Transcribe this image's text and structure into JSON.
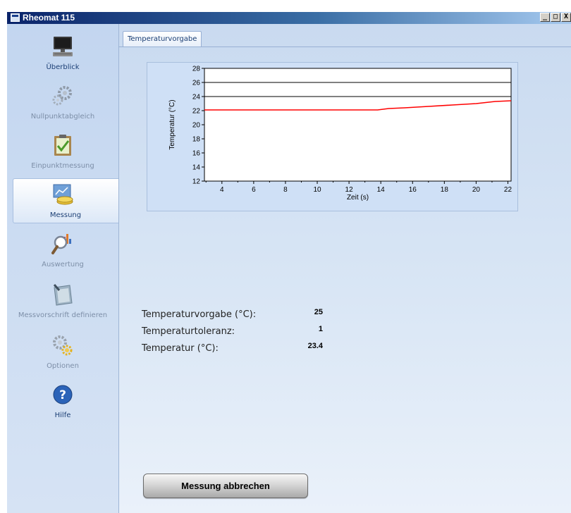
{
  "window": {
    "title": "Rheomat 115",
    "buttons": {
      "minimize": "_",
      "maximize": "□",
      "close": "X"
    }
  },
  "sidebar": {
    "items": [
      {
        "label": "Überblick",
        "icon": "computer-icon",
        "state": "enabled"
      },
      {
        "label": "Nullpunktabgleich",
        "icon": "gears-icon",
        "state": "disabled"
      },
      {
        "label": "Einpunktmessung",
        "icon": "clipboard-check-icon",
        "state": "disabled"
      },
      {
        "label": "Messung",
        "icon": "measurement-icon",
        "state": "active"
      },
      {
        "label": "Auswertung",
        "icon": "magnifier-chart-icon",
        "state": "disabled"
      },
      {
        "label": "Messvorschrift definieren",
        "icon": "notepad-icon",
        "state": "disabled"
      },
      {
        "label": "Optionen",
        "icon": "settings-icon",
        "state": "disabled"
      },
      {
        "label": "Hilfe",
        "icon": "help-icon",
        "state": "enabled"
      }
    ]
  },
  "tabs": [
    {
      "label": "Temperaturvorgabe",
      "active": true
    }
  ],
  "chart_data": {
    "type": "line",
    "title": "",
    "xlabel": "Zeit (s)",
    "ylabel": "Temperatur (°C)",
    "xlim": [
      2.9,
      22.2
    ],
    "ylim": [
      12,
      28
    ],
    "xticks": [
      4,
      6,
      8,
      10,
      12,
      14,
      16,
      18,
      20,
      22
    ],
    "yticks": [
      12,
      14,
      16,
      18,
      20,
      22,
      24,
      26,
      28
    ],
    "grid": false,
    "legend": "none",
    "series": [
      {
        "x": [
          2.9,
          22.2
        ],
        "y": [
          26,
          26
        ],
        "color": "#000000"
      },
      {
        "x": [
          2.9,
          22.2
        ],
        "y": [
          24,
          24
        ],
        "color": "#000000"
      },
      {
        "x": [
          2.9,
          13.8,
          14.5,
          15.5,
          17,
          18.5,
          20,
          21.2,
          22.2
        ],
        "y": [
          22.1,
          22.1,
          22.3,
          22.4,
          22.6,
          22.8,
          23.0,
          23.3,
          23.4
        ],
        "color": "#ff0000"
      }
    ]
  },
  "info": {
    "target_label": "Temperaturvorgabe (°C):",
    "target_value": "25",
    "tolerance_label": "Temperaturtoleranz:",
    "tolerance_value": "1",
    "temp_label": "Temperatur (°C):",
    "temp_value": "23.4"
  },
  "actions": {
    "abort_label": "Messung abbrechen"
  }
}
